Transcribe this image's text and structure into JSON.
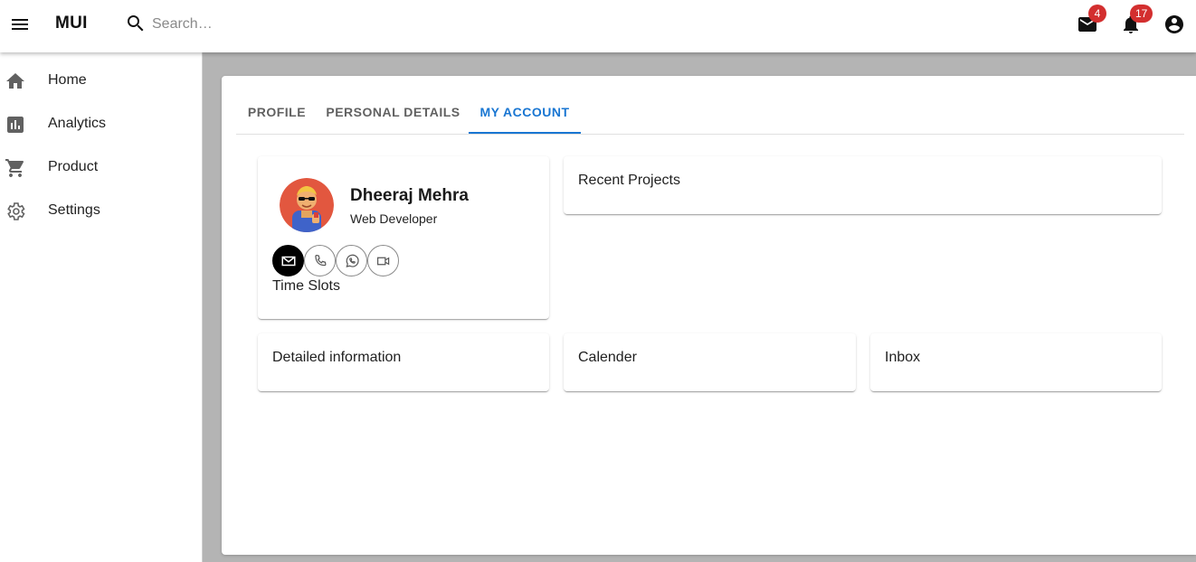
{
  "appbar": {
    "brand": "MUI",
    "search_placeholder": "Search…",
    "icons": {
      "menu": "menu-icon",
      "search": "search-icon",
      "mail": "mail-icon",
      "notifications": "bell-icon",
      "account": "account-circle-icon"
    },
    "mail_count": "4",
    "notification_count": "17",
    "badge_color": "#d32f2f"
  },
  "sidebar": {
    "items": [
      {
        "label": "Home",
        "icon": "home-icon"
      },
      {
        "label": "Analytics",
        "icon": "bar-chart-icon"
      },
      {
        "label": "Product",
        "icon": "cart-icon"
      },
      {
        "label": "Settings",
        "icon": "gear-icon"
      }
    ]
  },
  "tabs": [
    {
      "label": "PROFILE",
      "active": false
    },
    {
      "label": "PERSONAL DETAILS",
      "active": false
    },
    {
      "label": "MY ACCOUNT",
      "active": true
    }
  ],
  "accent_color": "#1976d2",
  "profile_card": {
    "name": "Dheeraj Mehra",
    "role": "Web Developer",
    "contacts": [
      {
        "icon": "mail-outline-icon",
        "active": true
      },
      {
        "icon": "phone-icon",
        "active": false
      },
      {
        "icon": "whatsapp-icon",
        "active": false
      },
      {
        "icon": "video-call-icon",
        "active": false
      }
    ],
    "timeslots_label": "Time Slots"
  },
  "cards": {
    "recent_projects": "Recent Projects",
    "detailed_information": "Detailed information",
    "calender": "Calender",
    "inbox": "Inbox"
  }
}
